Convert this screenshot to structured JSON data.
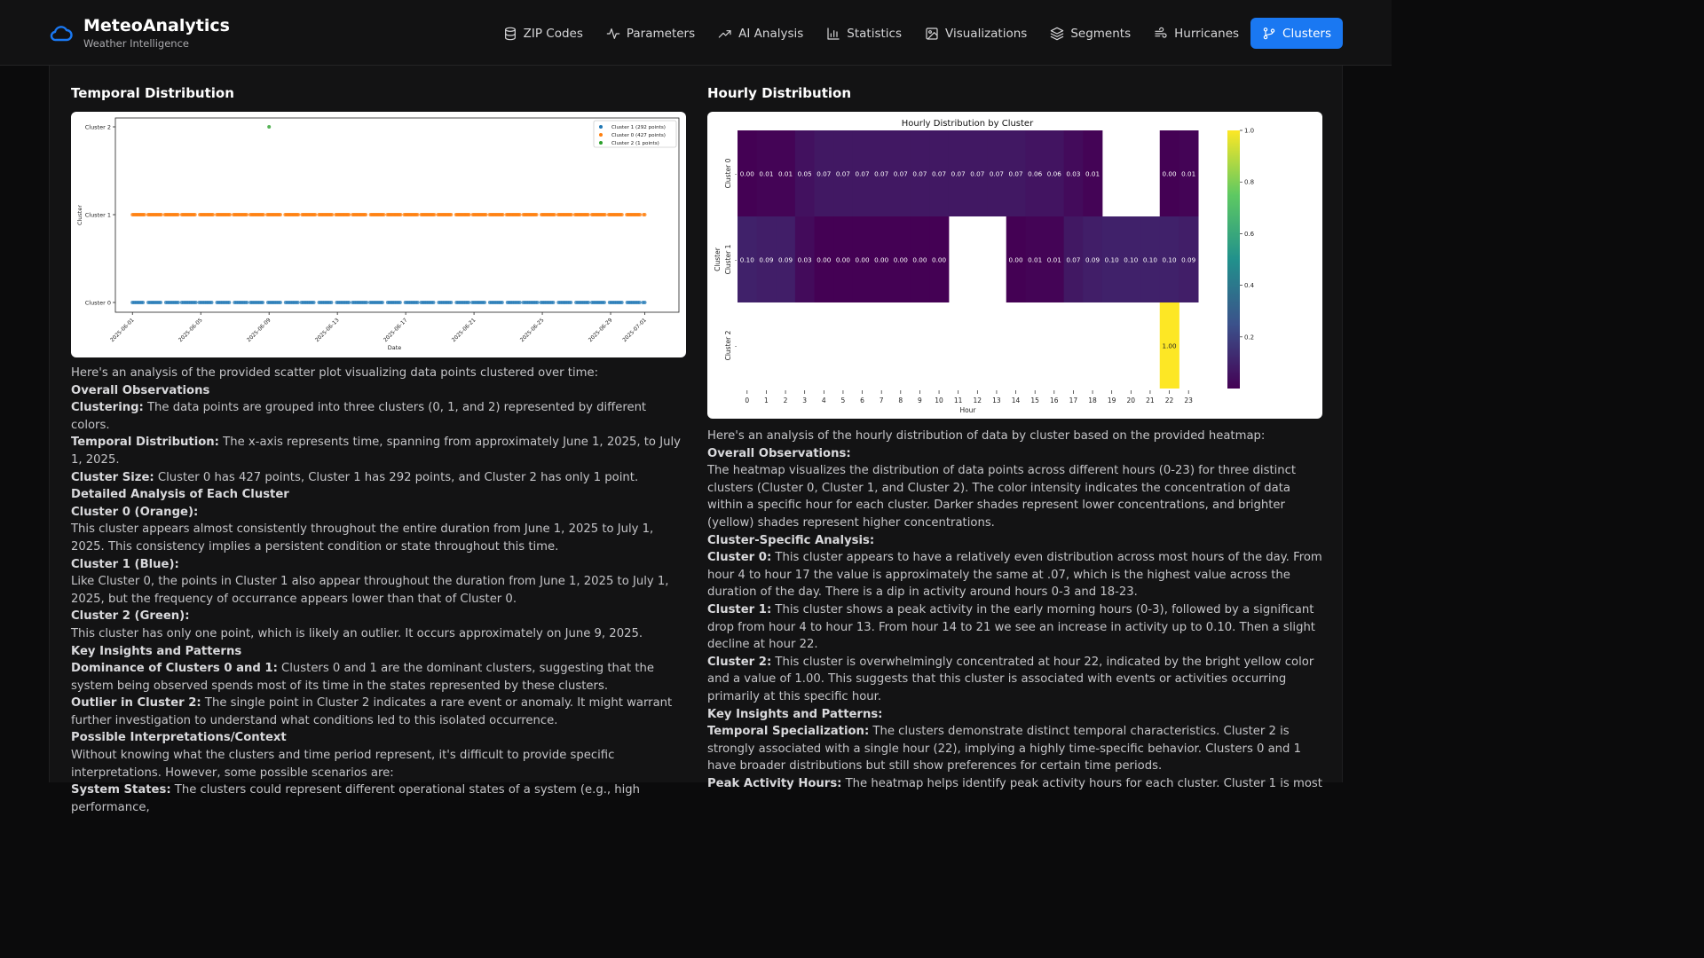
{
  "brand": {
    "title": "MeteoAnalytics",
    "subtitle": "Weather Intelligence"
  },
  "nav": [
    {
      "label": "ZIP Codes",
      "icon": "database-icon"
    },
    {
      "label": "Parameters",
      "icon": "activity-icon"
    },
    {
      "label": "AI Analysis",
      "icon": "trending-up-icon"
    },
    {
      "label": "Statistics",
      "icon": "bar-chart-icon"
    },
    {
      "label": "Visualizations",
      "icon": "image-icon"
    },
    {
      "label": "Segments",
      "icon": "layers-icon"
    },
    {
      "label": "Hurricanes",
      "icon": "wind-icon"
    },
    {
      "label": "Clusters",
      "icon": "git-branch-icon",
      "active": true
    }
  ],
  "colors": {
    "accent": "#1a78f2",
    "cluster0": "#ff7f0e",
    "cluster1": "#1f77b4",
    "cluster2": "#2ca02c"
  },
  "temporal": {
    "title": "Temporal Distribution",
    "analysis": [
      {
        "text": "Here's an analysis of the provided scatter plot visualizing data points clustered over time:"
      },
      {
        "bold": "Overall Observations"
      },
      {
        "bold": "Clustering:",
        "text": " The data points are grouped into three clusters (0, 1, and 2) represented by different colors."
      },
      {
        "bold": "Temporal Distribution:",
        "text": " The x-axis represents time, spanning from approximately June 1, 2025, to July 1, 2025."
      },
      {
        "bold": "Cluster Size:",
        "text": " Cluster 0 has 427 points, Cluster 1 has 292 points, and Cluster 2 has only 1 point."
      },
      {
        "bold": "Detailed Analysis of Each Cluster"
      },
      {
        "bold": "Cluster 0 (Orange):"
      },
      {
        "text": "This cluster appears almost consistently throughout the entire duration from June 1, 2025 to July 1, 2025. This consistency implies a persistent condition or state throughout this time."
      },
      {
        "bold": "Cluster 1 (Blue):"
      },
      {
        "text": "Like Cluster 0, the points in Cluster 1 also appear throughout the duration from June 1, 2025 to July 1, 2025, but the frequency of occurrance appears lower than that of Cluster 0."
      },
      {
        "bold": "Cluster 2 (Green):"
      },
      {
        "text": "This cluster has only one point, which is likely an outlier. It occurs approximately on June 9, 2025."
      },
      {
        "bold": "Key Insights and Patterns"
      },
      {
        "bold": "Dominance of Clusters 0 and 1:",
        "text": " Clusters 0 and 1 are the dominant clusters, suggesting that the system being observed spends most of its time in the states represented by these clusters."
      },
      {
        "bold": "Outlier in Cluster 2:",
        "text": " The single point in Cluster 2 indicates a rare event or anomaly. It might warrant further investigation to understand what conditions led to this isolated occurrence."
      },
      {
        "bold": "Possible Interpretations/Context"
      },
      {
        "text": "Without knowing what the clusters and time period represent, it's difficult to provide specific interpretations. However, some possible scenarios are:"
      },
      {
        "bold": "System States:",
        "text": " The clusters could represent different operational states of a system (e.g., high performance,"
      }
    ]
  },
  "hourly": {
    "title": "Hourly Distribution",
    "analysis": [
      {
        "text": "Here's an analysis of the hourly distribution of data by cluster based on the provided heatmap:"
      },
      {
        "bold": "Overall Observations:"
      },
      {
        "text": "The heatmap visualizes the distribution of data points across different hours (0-23) for three distinct clusters (Cluster 0, Cluster 1, and Cluster 2). The color intensity indicates the concentration of data within a specific hour for each cluster. Darker shades represent lower concentrations, and brighter (yellow) shades represent higher concentrations."
      },
      {
        "bold": "Cluster-Specific Analysis:"
      },
      {
        "bold": "Cluster 0:",
        "text": " This cluster appears to have a relatively even distribution across most hours of the day. From hour 4 to hour 17 the value is approximately the same at .07, which is the highest value across the duration of the day. There is a dip in activity around hours 0-3 and 18-23."
      },
      {
        "bold": "Cluster 1:",
        "text": " This cluster shows a peak activity in the early morning hours (0-3), followed by a significant drop from hour 4 to hour 13. From hour 14 to 21 we see an increase in activity up to 0.10. Then a slight decline at hour 22."
      },
      {
        "bold": "Cluster 2:",
        "text": " This cluster is overwhelmingly concentrated at hour 22, indicated by the bright yellow color and a value of 1.00. This suggests that this cluster is associated with events or activities occurring primarily at this specific hour."
      },
      {
        "bold": "Key Insights and Patterns:"
      },
      {
        "bold": "Temporal Specialization:",
        "text": " The clusters demonstrate distinct temporal characteristics. Cluster 2 is strongly associated with a single hour (22), implying a highly time-specific behavior. Clusters 0 and 1 have broader distributions but still show preferences for certain time periods."
      },
      {
        "bold": "Peak Activity Hours:",
        "text": " The heatmap helps identify peak activity hours for each cluster. Cluster 1 is most"
      }
    ]
  },
  "chart_data": [
    {
      "type": "scatter",
      "title": "",
      "xlabel": "Date",
      "ylabel": "Cluster",
      "x_ticks": [
        "2025-06-01",
        "2025-06-05",
        "2025-06-09",
        "2025-06-13",
        "2025-06-17",
        "2025-06-21",
        "2025-06-25",
        "2025-06-29",
        "2025-07-01"
      ],
      "xlim": [
        "2025-05-31",
        "2025-07-03"
      ],
      "y_ticks": [
        "Cluster 0",
        "Cluster 1",
        "Cluster 2"
      ],
      "legend_position": "top-right",
      "series": [
        {
          "name": "Cluster 1 (292 points)",
          "cluster": 0,
          "color": "#1f77b4",
          "x_range": [
            "2025-06-01",
            "2025-07-01"
          ],
          "count": 292
        },
        {
          "name": "Cluster 0 (427 points)",
          "cluster": 1,
          "color": "#ff7f0e",
          "x_range": [
            "2025-06-01",
            "2025-07-01"
          ],
          "count": 427
        },
        {
          "name": "Cluster 2 (1 points)",
          "cluster": 2,
          "color": "#2ca02c",
          "x": "2025-06-09",
          "count": 1
        }
      ]
    },
    {
      "type": "heatmap",
      "title": "Hourly Distribution by Cluster",
      "xlabel": "Hour",
      "ylabel": "Cluster",
      "x": [
        "0",
        "1",
        "2",
        "3",
        "4",
        "5",
        "6",
        "7",
        "8",
        "9",
        "10",
        "11",
        "12",
        "13",
        "14",
        "15",
        "16",
        "17",
        "18",
        "19",
        "20",
        "21",
        "22",
        "23"
      ],
      "y": [
        "Cluster 0",
        "Cluster 1",
        "Cluster 2"
      ],
      "y_tick_suffix": "-",
      "colorbar_ticks": [
        "0.2",
        "0.4",
        "0.6",
        "0.8",
        "1.0"
      ],
      "colormap": "viridis",
      "values": [
        [
          0.0,
          0.01,
          0.01,
          0.05,
          0.07,
          0.07,
          0.07,
          0.07,
          0.07,
          0.07,
          0.07,
          0.07,
          0.07,
          0.07,
          0.07,
          0.06,
          0.06,
          0.03,
          0.01,
          null,
          null,
          null,
          0.0,
          0.01
        ],
        [
          0.1,
          0.09,
          0.09,
          0.03,
          0.0,
          0.0,
          0.0,
          0.0,
          0.0,
          0.0,
          0.0,
          null,
          null,
          null,
          0.0,
          0.01,
          0.01,
          0.07,
          0.09,
          0.1,
          0.1,
          0.1,
          0.1,
          0.09
        ],
        [
          null,
          null,
          null,
          null,
          null,
          null,
          null,
          null,
          null,
          null,
          null,
          null,
          null,
          null,
          null,
          null,
          null,
          null,
          null,
          null,
          null,
          null,
          1.0,
          null
        ]
      ]
    }
  ]
}
